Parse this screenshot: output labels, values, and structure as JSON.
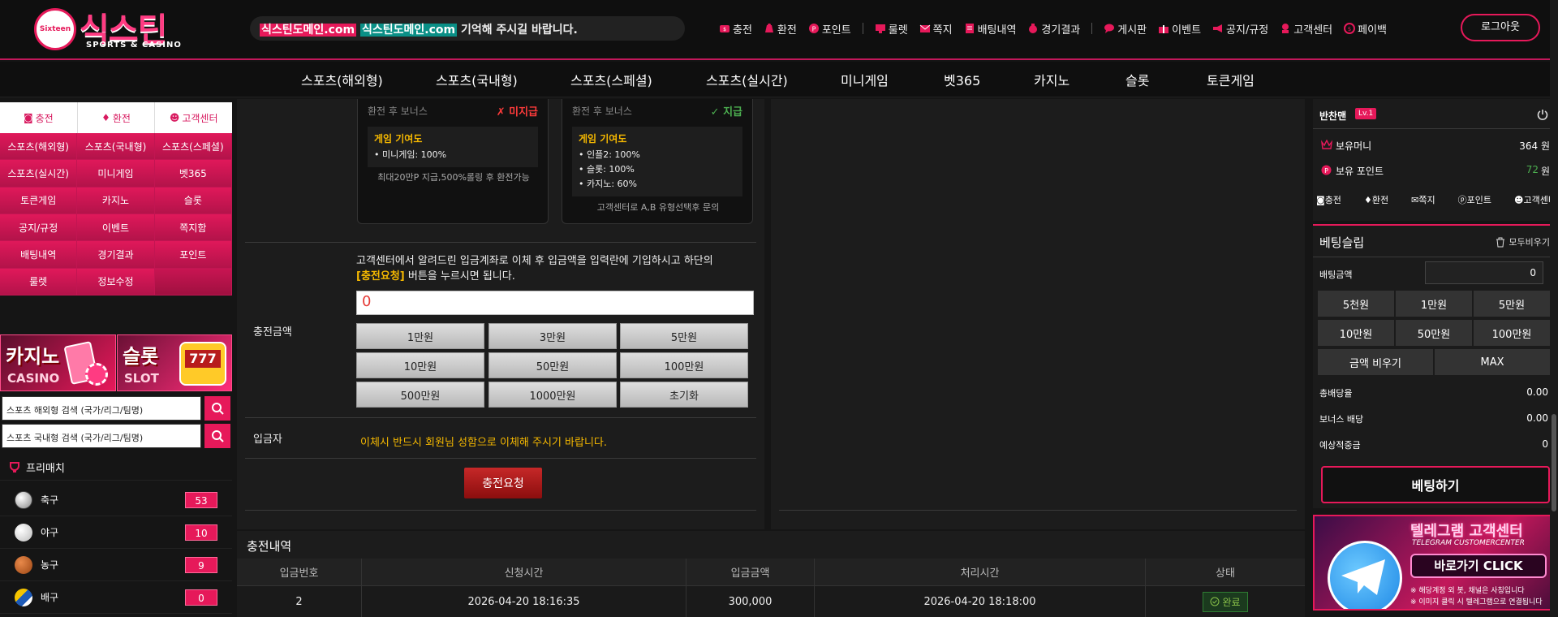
{
  "header": {
    "logo_main": "식스틴",
    "logo_badge": "Sixteen",
    "logo_sub": "SPORTS & CASINO",
    "notice_pre": "식스틴도메인.com",
    "notice_mid": "식스틴도메인.com",
    "notice_post": " 기억해 주시길 바랍니다.",
    "nav": [
      {
        "label": "충전",
        "icon": "charge-icon"
      },
      {
        "label": "환전",
        "icon": "exchange-icon"
      },
      {
        "label": "포인트",
        "icon": "point-icon"
      },
      {
        "label": "룰렛",
        "icon": "roulette-icon"
      },
      {
        "label": "쪽지",
        "icon": "mail-icon"
      },
      {
        "label": "배팅내역",
        "icon": "betting-history-icon"
      },
      {
        "label": "경기결과",
        "icon": "result-icon"
      },
      {
        "label": "게시판",
        "icon": "board-icon"
      },
      {
        "label": "이벤트",
        "icon": "gift-icon"
      },
      {
        "label": "공지/규정",
        "icon": "megaphone-icon"
      },
      {
        "label": "고객센터",
        "icon": "support-icon"
      },
      {
        "label": "페이백",
        "icon": "payback-icon"
      }
    ],
    "logout": "로그아웃"
  },
  "mainnav": [
    "스포츠(해외형)",
    "스포츠(국내형)",
    "스포츠(스페셜)",
    "스포츠(실시간)",
    "미니게임",
    "벳365",
    "카지노",
    "슬롯",
    "토큰게임"
  ],
  "left": {
    "quick_tabs": [
      {
        "label": "충전",
        "icon": "charge-icon"
      },
      {
        "label": "환전",
        "icon": "exchange-icon"
      },
      {
        "label": "고객센터",
        "icon": "support-icon"
      }
    ],
    "grid": [
      "스포츠(해외형)",
      "스포츠(국내형)",
      "스포츠(스페셜)",
      "스포츠(실시간)",
      "미니게임",
      "벳365",
      "토큰게임",
      "카지노",
      "슬롯",
      "공지/규정",
      "이벤트",
      "쪽지함",
      "배팅내역",
      "경기결과",
      "포인트",
      "룰렛",
      "정보수정"
    ],
    "banner_casino": {
      "title": "카지노",
      "sub": "CASINO"
    },
    "banner_slot": {
      "title": "슬롯",
      "sub": "SLOT",
      "badge": "777"
    },
    "search_overseas": "스포츠 해외형 검색 (국가/리그/팀명)",
    "search_domestic": "스포츠 국내형 검색 (국가/리그/팀명)",
    "prematch": "프리매치",
    "sports": [
      {
        "name": "축구",
        "count": "53"
      },
      {
        "name": "야구",
        "count": "10"
      },
      {
        "name": "농구",
        "count": "9"
      },
      {
        "name": "배구",
        "count": "0"
      }
    ]
  },
  "charge": {
    "card1": {
      "head": "환전 후 보너스",
      "status": "✗ 미지급",
      "box_title": "게임 기여도",
      "items": [
        "• 미니게임: 100%"
      ],
      "foot": "최대20만P 지급,500%롤링 후 환전가능"
    },
    "card2": {
      "head": "환전 후 보너스",
      "status": "✓ 지급",
      "box_title": "게임 기여도",
      "items": [
        "• 인플2: 100%",
        "• 슬롯: 100%",
        "• 카지노: 60%"
      ],
      "foot": "고객센터로 A,B 유형선택후 문의"
    },
    "instr1": "고객센터에서 알려드린 입금계좌로 이체 후 입금액을 입력란에 기입하시고 하단의",
    "instr_hl": "[충전요청]",
    "instr2": " 버튼을 누르시면 됩니다.",
    "amount_label": "충전금액",
    "amount_value": "0",
    "amount_buttons": [
      "1만원",
      "3만원",
      "5만원",
      "10만원",
      "50만원",
      "100만원",
      "500만원",
      "1000만원",
      "초기화"
    ],
    "depositor_label": "입금자",
    "depositor_msg": "이체시 반드시 회원님 성함으로 이체해 주시기 바랍니다.",
    "request_btn": "충전요청"
  },
  "history": {
    "title": "충전내역",
    "headers": [
      "입금번호",
      "신청시간",
      "입금금액",
      "처리시간",
      "상태"
    ],
    "rows": [
      {
        "no": "2",
        "req_time": "2026-04-20 18:16:35",
        "amount": "300,000",
        "proc_time": "2026-04-20 18:18:00",
        "status": "완료"
      }
    ]
  },
  "account": {
    "username": "반찬맨",
    "level": "Lv.1",
    "money_label": "보유머니",
    "money_value": "364 원",
    "point_label": "보유 포인트",
    "point_value": "72",
    "point_unit": "원",
    "links": [
      {
        "label": "충전",
        "icon": "charge-icon"
      },
      {
        "label": "환전",
        "icon": "exchange-icon"
      },
      {
        "label": "쪽지",
        "icon": "mail-icon"
      },
      {
        "label": "포인트",
        "icon": "point-icon"
      },
      {
        "label": "고객센터",
        "icon": "support-icon"
      }
    ]
  },
  "betslip": {
    "title": "베팅슬립",
    "clear_all": "모두비우기",
    "amount_label": "배팅금액",
    "amount_value": "0",
    "buttons": [
      "5천원",
      "1만원",
      "5만원",
      "10만원",
      "50만원",
      "100만원"
    ],
    "clear_amount": "금액 비우기",
    "max": "MAX",
    "total_odds_label": "총배당율",
    "total_odds_value": "0.00",
    "bonus_odds_label": "보너스 배당",
    "bonus_odds_value": "0.00",
    "expected_label": "예상적중금",
    "expected_value": "0",
    "bet_button": "베팅하기"
  },
  "telegram": {
    "title": "텔레그램 고객센터",
    "sub": "TELEGRAM CUSTOMERCENTER",
    "cta": "바로가기 CLICK",
    "note1": "※ 해당계정 외 봇, 채널은 사칭입니다",
    "note2": "※ 이미지 클릭 시 텔레그램으로 연결됩니다"
  },
  "colors": {
    "accent": "#e6195a",
    "gold": "#f5b800",
    "green": "#4caf50",
    "red": "#ff3b3b"
  }
}
